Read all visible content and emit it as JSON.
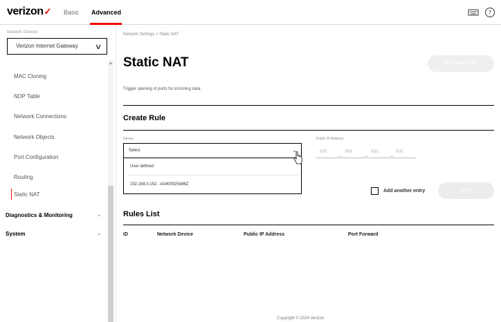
{
  "topbar": {
    "logo": "verizon",
    "nav": {
      "basic": "Basic",
      "advanced": "Advanced"
    },
    "icons": [
      "keyboard-icon",
      "help-icon"
    ]
  },
  "sidebar": {
    "caption": "Network Devices",
    "device_select": "Verizon Internet Gateway",
    "items": [
      {
        "label": "MAC Cloning"
      },
      {
        "label": "NDP Table"
      },
      {
        "label": "Network Connections"
      },
      {
        "label": "Network Objects"
      },
      {
        "label": "Port Configuration"
      },
      {
        "label": "Routing"
      },
      {
        "label": "Static NAT",
        "active": true
      }
    ],
    "groups": [
      {
        "label": "Diagnostics & Monitoring"
      },
      {
        "label": "System"
      }
    ]
  },
  "main": {
    "breadcrumb": "Network Settings > Static NAT",
    "title": "Static NAT",
    "title_button": "Edit Static NAT",
    "description": "Trigger opening of ports for incoming data.",
    "create_rule": {
      "heading": "Create Rule",
      "device_label": "Device",
      "device_value": "Select",
      "dropdown_options": [
        "User defined",
        "192.168.0.152 - A0400025486Z"
      ],
      "public_ip_label": "Public IP Address",
      "ip_octets": [
        "000",
        "000",
        "000",
        "000"
      ],
      "add_entry_label": "Add another entry",
      "save_label": "Save"
    },
    "rules_list": {
      "heading": "Rules List",
      "columns": [
        "ID",
        "Network Device",
        "Public IP Address",
        "Port Forward"
      ]
    }
  },
  "footer": "Copyright © 2024 Verizon",
  "colors": {
    "brand": "#ee0000",
    "text": "#000000",
    "muted": "#8a8a8a"
  }
}
